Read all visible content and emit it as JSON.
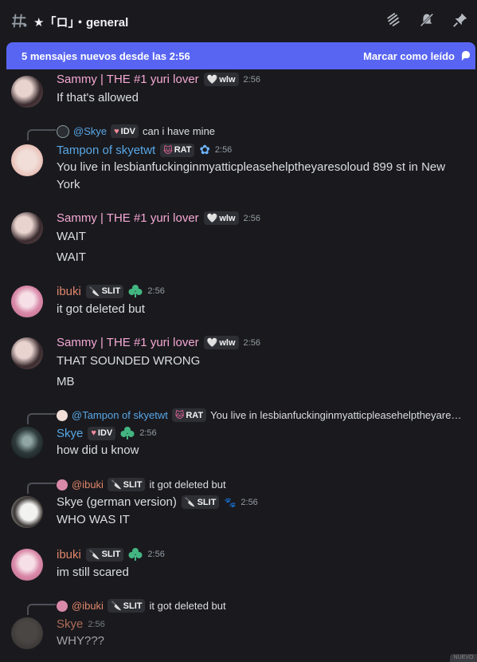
{
  "header": {
    "channel_name": "★「ロ」・general",
    "icons": [
      "threads-icon",
      "mute-icon",
      "pin-icon"
    ]
  },
  "banner": {
    "new_messages": "5 mensajes nuevos desde las 2:56",
    "mark_read": "Marcar como leído"
  },
  "messages": [
    {
      "author": "Sammy | THE #1 yuri lover",
      "author_color": "#f5a8d4",
      "tag": "wlw",
      "time": "2:56",
      "lines": [
        "If that's allowed"
      ]
    },
    {
      "reply": {
        "name": "@Skye",
        "name_color": "#58a6e6",
        "tag": "IDV",
        "text": "can i have mine"
      },
      "author": "Tampon of skyetwt",
      "author_color": "#58a6e6",
      "tag": "RAT",
      "time": "2:56",
      "lines": [
        "You live in lesbianfuckinginmyatticpleasehelptheyaresoloud 899 st in New York"
      ]
    },
    {
      "author": "Sammy | THE #1 yuri lover",
      "author_color": "#f5a8d4",
      "tag": "wlw",
      "time": "2:56",
      "lines": [
        "WAIT",
        "WAIT"
      ]
    },
    {
      "author": "ibuki",
      "author_color": "#e0866b",
      "tag": "SLIT",
      "time": "2:56",
      "lines": [
        "it got deleted but"
      ]
    },
    {
      "author": "Sammy | THE #1 yuri lover",
      "author_color": "#f5a8d4",
      "tag": "wlw",
      "time": "2:56",
      "lines": [
        "THAT SOUNDED WRONG",
        "MB"
      ]
    },
    {
      "reply": {
        "name": "@Tampon of skyetwt",
        "name_color": "#58a6e6",
        "tag": "RAT",
        "text": "You live in lesbianfuckinginmyatticpleasehelptheyare…"
      },
      "author": "Skye",
      "author_color": "#58a6e6",
      "tag": "IDV",
      "time": "2:56",
      "lines": [
        "how did u know"
      ]
    },
    {
      "reply": {
        "name": "@ibuki",
        "name_color": "#e0866b",
        "tag": "SLIT",
        "text": "it got deleted but"
      },
      "author": "Skye (german version)",
      "author_color": "#dbdee1",
      "tag": "SLIT",
      "time": "2:56",
      "lines": [
        "WHO WAS IT"
      ]
    },
    {
      "author": "ibuki",
      "author_color": "#e0866b",
      "tag": "SLIT",
      "time": "2:56",
      "lines": [
        "im still scared"
      ]
    },
    {
      "reply": {
        "name": "@ibuki",
        "name_color": "#e0866b",
        "tag": "SLIT",
        "text": "it got deleted but"
      },
      "author": "Skye",
      "author_color": "#e0866b",
      "time": "2:56",
      "lines": [
        "WHY???"
      ]
    }
  ],
  "corner_badge": "NUEVO"
}
